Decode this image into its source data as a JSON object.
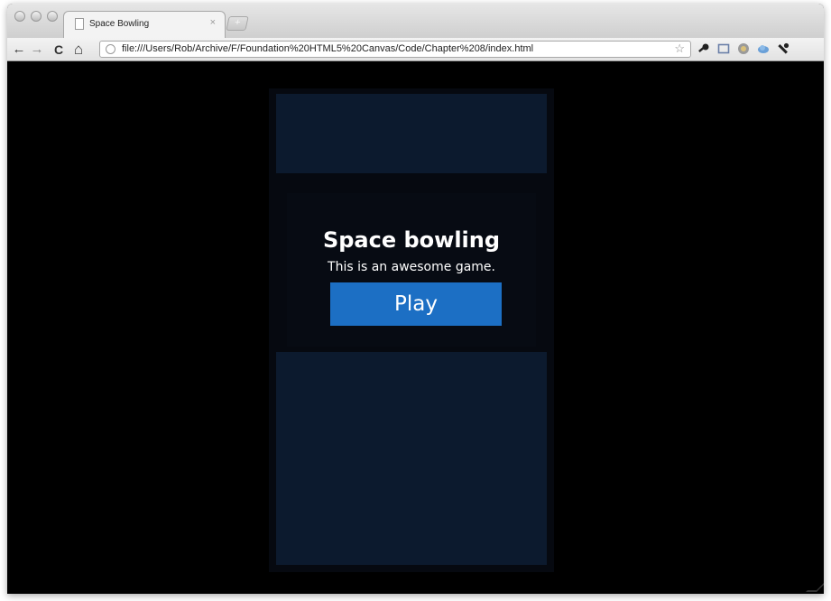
{
  "browser": {
    "tab_title": "Space Bowling",
    "tab_close_glyph": "×",
    "new_tab_glyph": "+",
    "url": "file:///Users/Rob/Archive/F/Foundation%20HTML5%20Canvas/Code/Chapter%208/index.html",
    "nav": {
      "back_glyph": "←",
      "forward_glyph": "→",
      "reload_glyph": "C",
      "home_glyph": "⌂"
    },
    "bookmark_glyph": "☆",
    "extensions": [
      "key-icon",
      "screen-icon",
      "globe-icon",
      "cloud-icon",
      "wrench-icon"
    ]
  },
  "game": {
    "title": "Space bowling",
    "subtitle": "This is an awesome game.",
    "play_label": "Play"
  },
  "colors": {
    "page_background": "#000000",
    "band": "#0c1a2e",
    "panel": "#070b13",
    "play_button": "#1c6fc4",
    "text": "#ffffff"
  }
}
